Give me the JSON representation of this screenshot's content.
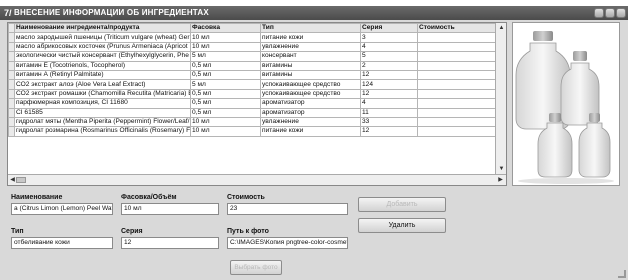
{
  "window": {
    "title": "ВНЕСЕНИЕ ИНФОРМАЦИИ ОБ ИНГРЕДИЕНТАХ",
    "icon": "7/"
  },
  "grid": {
    "columns": [
      "Наименование ингредиента/продукта",
      "Фасовка",
      "Тип",
      "Серия",
      "Стоимость"
    ],
    "rows": [
      [
        "масло зародышей пшеницы (Triticum vulgare (wheat) Ger",
        "10 мл",
        "питание кожи",
        "3",
        ""
      ],
      [
        "масло абрикосовых косточек (Prunus Armeniaca (Apricot",
        "10 мл",
        "увлажнение",
        "4",
        ""
      ],
      [
        "экологически чистый консервант (Ethylhexylglycerin, Phe",
        "5 мл",
        "консервант",
        "5",
        ""
      ],
      [
        "витамин E (Tocotrienols, Tocopherol)",
        "0,5 мл",
        "витамины",
        "2",
        ""
      ],
      [
        "витамин А (Retinyl Palmitate)",
        "0,5 мл",
        "витамины",
        "12",
        ""
      ],
      [
        "СО2 экстракт алоэ (Aloe Vera Leaf Extract)",
        "5 мл",
        "успокаивающее средство",
        "124",
        ""
      ],
      [
        "СО2 экстракт ромашки (Chamomilla Recutita (Matricaria) E",
        "0,5 мл",
        "успокаивающее средство",
        "12",
        ""
      ],
      [
        "парфюмерная композиция, CI 11680",
        "0,5 мл",
        "ароматизатор",
        "4",
        ""
      ],
      [
        "CI 61585",
        "0,5 мл",
        "ароматизатор",
        "11",
        ""
      ],
      [
        "гидролат мяты (Mentha Piperita (Peppermint) Flower/Leaf/",
        "10 мл",
        "увлажнение",
        "33",
        ""
      ],
      [
        "гидролат розмарина (Rosmarinus Officinalis (Rosemary) Fl",
        "10 мл",
        "питание кожи",
        "12",
        ""
      ]
    ]
  },
  "form": {
    "name_label": "Наименование",
    "name_value": "a (Citrus Limon (Lemon) Peel Water)",
    "pack_label": "Фасовка/Объём",
    "pack_value": "10 мл",
    "cost_label": "Стоимость",
    "cost_value": "23",
    "type_label": "Тип",
    "type_value": "отбеливание кожи",
    "series_label": "Серия",
    "series_value": "12",
    "photo_label": "Путь к фото",
    "photo_value": "C:\\IMAGES\\Копия pngtree-color-cosmetics-"
  },
  "buttons": {
    "add": "Добавить",
    "delete": "Удалить",
    "choose_photo": "Выбрать фото"
  },
  "icons": {
    "window": "app-icon",
    "image": "bottles-image"
  },
  "colors": {
    "titlebar": "#555555",
    "background": "#d9d9d9"
  }
}
